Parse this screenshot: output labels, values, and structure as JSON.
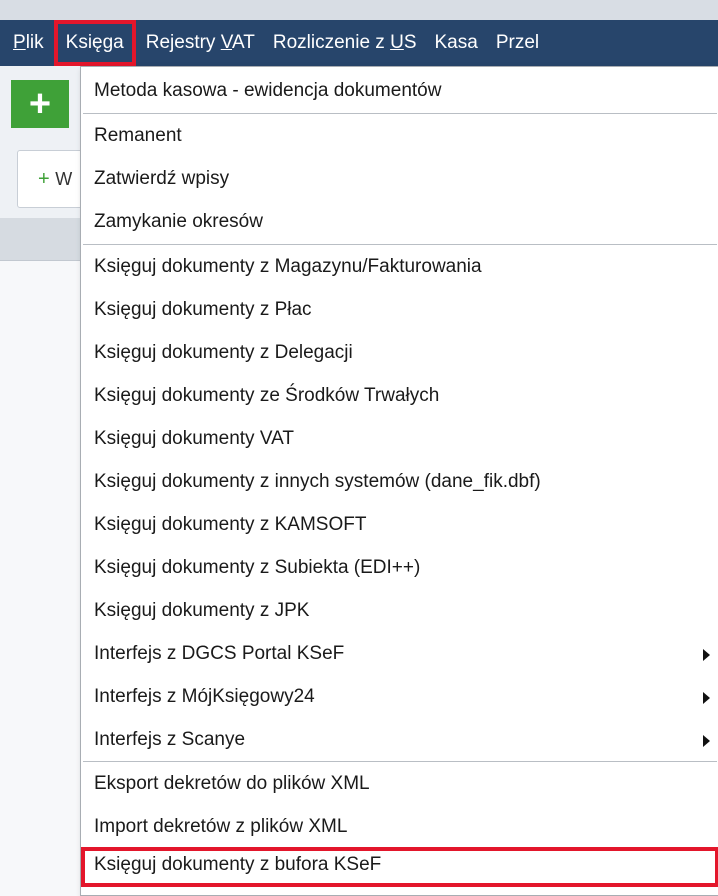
{
  "menubar": {
    "items": [
      {
        "text": "Plik",
        "underline": "P",
        "rest": "lik"
      },
      {
        "text": "Księga",
        "underline": "",
        "rest": "Księga"
      },
      {
        "text": "Rejestry VAT",
        "pre": "Rejestry ",
        "underline": "V",
        "rest": "AT"
      },
      {
        "text": "Rozliczenie z US",
        "pre": "Rozliczenie z ",
        "underline": "U",
        "rest": "S"
      },
      {
        "text": "Kasa",
        "underline": "",
        "rest": "Kasa"
      },
      {
        "text": "Przel",
        "underline": "",
        "rest": "Przel"
      }
    ]
  },
  "background": {
    "add_icon": "+",
    "add_button_icon": "+",
    "add_button_label": "W"
  },
  "dropdown": {
    "items": [
      {
        "label": "Metoda kasowa - ewidencja dokumentów"
      },
      {
        "label": "Remanent"
      },
      {
        "label": "Zatwierdź wpisy"
      },
      {
        "label": "Zamykanie okresów"
      },
      {
        "label": "Księguj dokumenty z Magazynu/Fakturowania"
      },
      {
        "label": "Księguj dokumenty z Płac"
      },
      {
        "label": "Księguj dokumenty z Delegacji"
      },
      {
        "label": "Księguj dokumenty ze Środków Trwałych"
      },
      {
        "label": "Księguj dokumenty VAT"
      },
      {
        "label": "Księguj dokumenty z innych systemów (dane_fik.dbf)"
      },
      {
        "label": "Księguj dokumenty z KAMSOFT"
      },
      {
        "label": "Księguj dokumenty z Subiekta (EDI++)"
      },
      {
        "label": "Księguj dokumenty z JPK"
      },
      {
        "label": "Interfejs z DGCS Portal KSeF",
        "submenu": true
      },
      {
        "label": "Interfejs z MójKsięgowy24",
        "submenu": true
      },
      {
        "label": "Interfejs z Scanye",
        "submenu": true
      },
      {
        "label": "Eksport dekretów do plików XML"
      },
      {
        "label": "Import dekretów z plików XML"
      },
      {
        "label": "Księguj dokumenty z bufora KSeF",
        "highlighted": true
      }
    ]
  },
  "colors": {
    "menubar_bg": "#27456b",
    "highlight_border": "#e3162b",
    "add_green": "#3fa138"
  }
}
